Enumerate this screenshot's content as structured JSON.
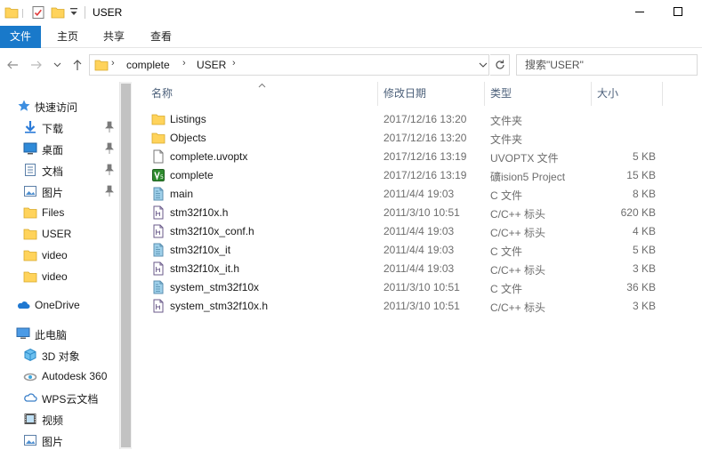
{
  "window": {
    "title": "USER"
  },
  "ribbon": {
    "tabs": [
      "文件",
      "主页",
      "共享",
      "查看"
    ]
  },
  "address": {
    "crumbs": [
      "complete",
      "USER"
    ]
  },
  "search": {
    "placeholder": "搜索\"USER\""
  },
  "nav": {
    "quick_access": "快速访问",
    "items": [
      {
        "label": "下载",
        "icon": "download-icon",
        "pinned": true
      },
      {
        "label": "桌面",
        "icon": "desktop-icon",
        "pinned": true
      },
      {
        "label": "文档",
        "icon": "document-icon",
        "pinned": true
      },
      {
        "label": "图片",
        "icon": "pictures-icon",
        "pinned": true
      },
      {
        "label": "Files",
        "icon": "folder-icon",
        "pinned": false
      },
      {
        "label": "USER",
        "icon": "folder-icon",
        "pinned": false
      },
      {
        "label": "video",
        "icon": "folder-icon",
        "pinned": false
      },
      {
        "label": "video",
        "icon": "folder-icon",
        "pinned": false
      }
    ],
    "onedrive": "OneDrive",
    "this_pc": "此电脑",
    "pc_items": [
      {
        "label": "3D 对象",
        "icon": "3d-objects-icon"
      },
      {
        "label": "Autodesk 360",
        "icon": "autodesk-icon"
      },
      {
        "label": "WPS云文档",
        "icon": "cloud-icon"
      },
      {
        "label": "视频",
        "icon": "video-icon"
      },
      {
        "label": "图片",
        "icon": "pictures-icon"
      }
    ]
  },
  "columns": {
    "name": "名称",
    "date": "修改日期",
    "type": "类型",
    "size": "大小"
  },
  "files": [
    {
      "name": "Listings",
      "date": "2017/12/16 13:20",
      "type": "文件夹",
      "size": "",
      "icon": "folder-icon"
    },
    {
      "name": "Objects",
      "date": "2017/12/16 13:20",
      "type": "文件夹",
      "size": "",
      "icon": "folder-icon"
    },
    {
      "name": "complete.uvoptx",
      "date": "2017/12/16 13:19",
      "type": "UVOPTX 文件",
      "size": "5 KB",
      "icon": "file-icon"
    },
    {
      "name": "complete",
      "date": "2017/12/16 13:19",
      "type": "礦ision5 Project",
      "size": "15 KB",
      "icon": "keil-project-icon"
    },
    {
      "name": "main",
      "date": "2011/4/4 19:03",
      "type": "C 文件",
      "size": "8 KB",
      "icon": "c-file-icon"
    },
    {
      "name": "stm32f10x.h",
      "date": "2011/3/10 10:51",
      "type": "C/C++ 标头",
      "size": "620 KB",
      "icon": "header-file-icon"
    },
    {
      "name": "stm32f10x_conf.h",
      "date": "2011/4/4 19:03",
      "type": "C/C++ 标头",
      "size": "4 KB",
      "icon": "header-file-icon"
    },
    {
      "name": "stm32f10x_it",
      "date": "2011/4/4 19:03",
      "type": "C 文件",
      "size": "5 KB",
      "icon": "c-file-icon"
    },
    {
      "name": "stm32f10x_it.h",
      "date": "2011/4/4 19:03",
      "type": "C/C++ 标头",
      "size": "3 KB",
      "icon": "header-file-icon"
    },
    {
      "name": "system_stm32f10x",
      "date": "2011/3/10 10:51",
      "type": "C 文件",
      "size": "36 KB",
      "icon": "c-file-icon"
    },
    {
      "name": "system_stm32f10x.h",
      "date": "2011/3/10 10:51",
      "type": "C/C++ 标头",
      "size": "3 KB",
      "icon": "header-file-icon"
    }
  ],
  "colors": {
    "accent": "#1979ca",
    "folder": "#ffd35b",
    "header_text": "#4c607a",
    "meta_text": "#6d6d6d"
  }
}
